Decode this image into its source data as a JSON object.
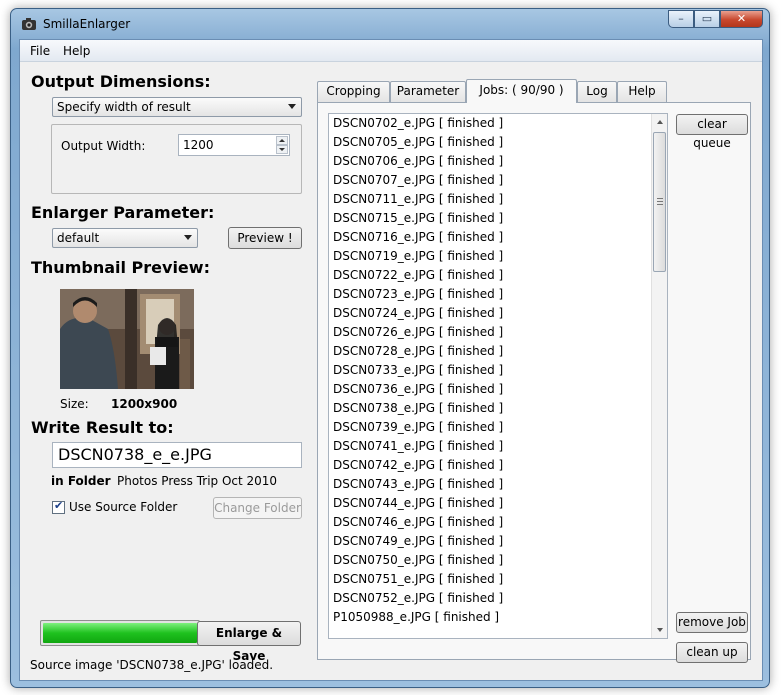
{
  "window": {
    "title": "SmillaEnlarger"
  },
  "menu": {
    "file": "File",
    "help": "Help"
  },
  "output_dimensions": {
    "heading": "Output Dimensions:",
    "mode": "Specify width of result",
    "width_label": "Output Width:",
    "width_value": "1200"
  },
  "enlarger": {
    "heading": "Enlarger Parameter:",
    "preset": "default",
    "preview_button": "Preview !"
  },
  "thumbnail": {
    "heading": "Thumbnail Preview:",
    "size_label": "Size:",
    "size_value": "1200x900"
  },
  "write_result": {
    "heading": "Write Result to:",
    "filename": "DSCN0738_e_e.JPG",
    "in_folder_label": "in Folder",
    "folder_value": "Photos Press Trip Oct 2010",
    "use_source_folder_label": "Use Source Folder",
    "use_source_folder_checked": true,
    "change_folder_button": "Change Folder"
  },
  "progress": {
    "percent": 100
  },
  "enlarge_save_button": "Enlarge & Save",
  "status": "Source image 'DSCN0738_e.JPG' loaded.",
  "tabs": [
    {
      "label": "Cropping",
      "active": false
    },
    {
      "label": "Parameter",
      "active": false
    },
    {
      "label": "Jobs: ( 90/90 )",
      "active": true
    },
    {
      "label": "Log",
      "active": false
    },
    {
      "label": "Help",
      "active": false
    }
  ],
  "jobs": {
    "clear_queue_button": "clear queue",
    "remove_job_button": "remove Job",
    "clean_up_button": "clean up",
    "items": [
      "DSCN0702_e.JPG [ finished ]",
      "DSCN0705_e.JPG [ finished ]",
      "DSCN0706_e.JPG [ finished ]",
      "DSCN0707_e.JPG [ finished ]",
      "DSCN0711_e.JPG [ finished ]",
      "DSCN0715_e.JPG [ finished ]",
      "DSCN0716_e.JPG [ finished ]",
      "DSCN0719_e.JPG [ finished ]",
      "DSCN0722_e.JPG [ finished ]",
      "DSCN0723_e.JPG [ finished ]",
      "DSCN0724_e.JPG [ finished ]",
      "DSCN0726_e.JPG [ finished ]",
      "DSCN0728_e.JPG [ finished ]",
      "DSCN0733_e.JPG [ finished ]",
      "DSCN0736_e.JPG [ finished ]",
      "DSCN0738_e.JPG [ finished ]",
      "DSCN0739_e.JPG [ finished ]",
      "DSCN0741_e.JPG [ finished ]",
      "DSCN0742_e.JPG [ finished ]",
      "DSCN0743_e.JPG [ finished ]",
      "DSCN0744_e.JPG [ finished ]",
      "DSCN0746_e.JPG [ finished ]",
      "DSCN0749_e.JPG [ finished ]",
      "DSCN0750_e.JPG [ finished ]",
      "DSCN0751_e.JPG [ finished ]",
      "DSCN0752_e.JPG [ finished ]",
      "P1050988_e.JPG [ finished ]"
    ]
  }
}
